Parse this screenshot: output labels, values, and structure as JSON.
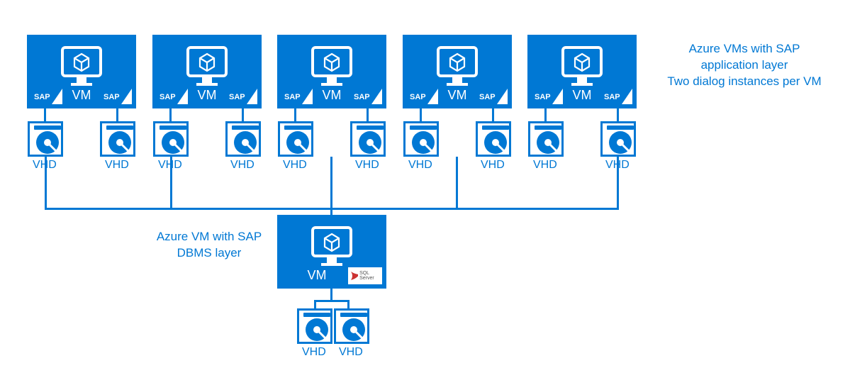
{
  "diagram": {
    "app_layer": {
      "annotation_line1": "Azure VMs with SAP",
      "annotation_line2": "application layer",
      "annotation_line3": "Two dialog instances per VM",
      "vms": [
        {
          "label": "VM",
          "badge_left": "SAP",
          "badge_right": "SAP",
          "vhd_left": "VHD",
          "vhd_right": "VHD"
        },
        {
          "label": "VM",
          "badge_left": "SAP",
          "badge_right": "SAP",
          "vhd_left": "VHD",
          "vhd_right": "VHD"
        },
        {
          "label": "VM",
          "badge_left": "SAP",
          "badge_right": "SAP",
          "vhd_left": "VHD",
          "vhd_right": "VHD"
        },
        {
          "label": "VM",
          "badge_left": "SAP",
          "badge_right": "SAP",
          "vhd_left": "VHD",
          "vhd_right": "VHD"
        },
        {
          "label": "VM",
          "badge_left": "SAP",
          "badge_right": "SAP",
          "vhd_left": "VHD",
          "vhd_right": "VHD"
        }
      ]
    },
    "dbms_layer": {
      "annotation_line1": "Azure VM with SAP",
      "annotation_line2": "DBMS layer",
      "vm": {
        "label": "VM",
        "badge_sql": "SQL Server",
        "vhd_left": "VHD",
        "vhd_right": "VHD"
      }
    }
  }
}
